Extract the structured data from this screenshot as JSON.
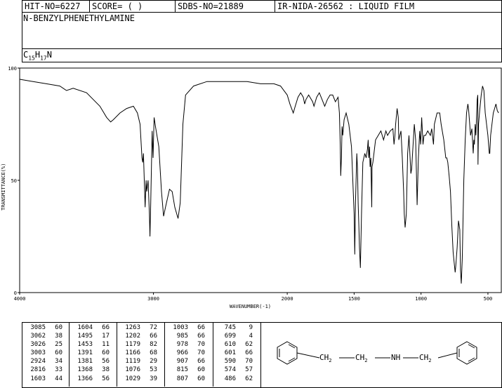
{
  "header": {
    "hit_no": "HIT-NO=6227",
    "score": "SCORE=  (  )",
    "sdbs_no": "SDBS-NO=21889",
    "ir_nida": "IR-NIDA-26562 : LIQUID FILM"
  },
  "compound": {
    "name": "N-BENZYLPHENETHYLAMINE",
    "formula_c": "C",
    "formula_c_sub": "15",
    "formula_h": "H",
    "formula_h_sub": "17",
    "formula_n": "N"
  },
  "chart_data": {
    "type": "line",
    "title": "",
    "xlabel": "WAVENUMBER(-1)",
    "ylabel": "TRANSMITTANCE(%)",
    "xlim": [
      4000,
      400
    ],
    "ylim": [
      0,
      100
    ],
    "x_ticks": [
      4000,
      3000,
      2000,
      1500,
      1000,
      500
    ],
    "y_ticks": [
      0,
      50,
      100
    ],
    "x_tick_labels": [
      "4000",
      "3000",
      "2000",
      "1500",
      "1000",
      "500"
    ],
    "y_tick_labels": [
      "0",
      "50",
      "100"
    ],
    "grid": false,
    "series": [
      {
        "points": [
          [
            4000,
            95
          ],
          [
            3900,
            94
          ],
          [
            3800,
            93
          ],
          [
            3700,
            92
          ],
          [
            3650,
            90
          ],
          [
            3600,
            91
          ],
          [
            3500,
            89
          ],
          [
            3450,
            86
          ],
          [
            3400,
            83
          ],
          [
            3350,
            78
          ],
          [
            3320,
            76
          ],
          [
            3300,
            77
          ],
          [
            3250,
            80
          ],
          [
            3200,
            82
          ],
          [
            3150,
            83
          ],
          [
            3120,
            80
          ],
          [
            3100,
            75
          ],
          [
            3086,
            60
          ],
          [
            3080,
            58
          ],
          [
            3075,
            62
          ],
          [
            3062,
            38
          ],
          [
            3055,
            50
          ],
          [
            3050,
            45
          ],
          [
            3040,
            50
          ],
          [
            3030,
            35
          ],
          [
            3026,
            25
          ],
          [
            3020,
            40
          ],
          [
            3010,
            72
          ],
          [
            3003,
            60
          ],
          [
            2995,
            78
          ],
          [
            2985,
            74
          ],
          [
            2960,
            65
          ],
          [
            2940,
            45
          ],
          [
            2924,
            34
          ],
          [
            2910,
            38
          ],
          [
            2880,
            46
          ],
          [
            2860,
            45
          ],
          [
            2840,
            38
          ],
          [
            2816,
            33
          ],
          [
            2800,
            40
          ],
          [
            2780,
            75
          ],
          [
            2760,
            88
          ],
          [
            2700,
            92
          ],
          [
            2600,
            94
          ],
          [
            2500,
            94
          ],
          [
            2400,
            94
          ],
          [
            2300,
            94
          ],
          [
            2200,
            93
          ],
          [
            2100,
            93
          ],
          [
            2050,
            92
          ],
          [
            2000,
            88
          ],
          [
            1980,
            84
          ],
          [
            1955,
            80
          ],
          [
            1940,
            83
          ],
          [
            1920,
            87
          ],
          [
            1900,
            89
          ],
          [
            1880,
            87
          ],
          [
            1870,
            84
          ],
          [
            1860,
            86
          ],
          [
            1840,
            88
          ],
          [
            1810,
            85
          ],
          [
            1800,
            83
          ],
          [
            1780,
            87
          ],
          [
            1760,
            89
          ],
          [
            1740,
            86
          ],
          [
            1720,
            83
          ],
          [
            1700,
            86
          ],
          [
            1680,
            88
          ],
          [
            1660,
            88
          ],
          [
            1640,
            85
          ],
          [
            1620,
            87
          ],
          [
            1610,
            80
          ],
          [
            1604,
            66
          ],
          [
            1600,
            52
          ],
          [
            1595,
            60
          ],
          [
            1590,
            74
          ],
          [
            1585,
            70
          ],
          [
            1575,
            77
          ],
          [
            1560,
            80
          ],
          [
            1540,
            75
          ],
          [
            1520,
            65
          ],
          [
            1500,
            35
          ],
          [
            1495,
            17
          ],
          [
            1490,
            40
          ],
          [
            1480,
            62
          ],
          [
            1475,
            55
          ],
          [
            1470,
            40
          ],
          [
            1465,
            30
          ],
          [
            1460,
            20
          ],
          [
            1453,
            11
          ],
          [
            1445,
            35
          ],
          [
            1435,
            58
          ],
          [
            1420,
            62
          ],
          [
            1410,
            60
          ],
          [
            1400,
            64
          ],
          [
            1395,
            68
          ],
          [
            1391,
            60
          ],
          [
            1385,
            65
          ],
          [
            1381,
            56
          ],
          [
            1375,
            60
          ],
          [
            1368,
            38
          ],
          [
            1366,
            56
          ],
          [
            1360,
            58
          ],
          [
            1340,
            68
          ],
          [
            1320,
            70
          ],
          [
            1300,
            72
          ],
          [
            1280,
            68
          ],
          [
            1263,
            72
          ],
          [
            1250,
            70
          ],
          [
            1230,
            72
          ],
          [
            1210,
            73
          ],
          [
            1202,
            66
          ],
          [
            1195,
            70
          ],
          [
            1190,
            75
          ],
          [
            1179,
            82
          ],
          [
            1170,
            78
          ],
          [
            1166,
            68
          ],
          [
            1150,
            72
          ],
          [
            1140,
            60
          ],
          [
            1130,
            45
          ],
          [
            1125,
            35
          ],
          [
            1119,
            29
          ],
          [
            1110,
            35
          ],
          [
            1100,
            62
          ],
          [
            1090,
            70
          ],
          [
            1076,
            53
          ],
          [
            1070,
            55
          ],
          [
            1060,
            65
          ],
          [
            1050,
            75
          ],
          [
            1040,
            68
          ],
          [
            1035,
            55
          ],
          [
            1029,
            39
          ],
          [
            1020,
            60
          ],
          [
            1010,
            72
          ],
          [
            1003,
            66
          ],
          [
            995,
            78
          ],
          [
            985,
            66
          ],
          [
            978,
            70
          ],
          [
            966,
            70
          ],
          [
            950,
            72
          ],
          [
            930,
            70
          ],
          [
            920,
            73
          ],
          [
            907,
            66
          ],
          [
            900,
            75
          ],
          [
            880,
            80
          ],
          [
            860,
            80
          ],
          [
            850,
            75
          ],
          [
            830,
            68
          ],
          [
            815,
            60
          ],
          [
            807,
            60
          ],
          [
            800,
            58
          ],
          [
            790,
            52
          ],
          [
            780,
            45
          ],
          [
            770,
            30
          ],
          [
            760,
            18
          ],
          [
            750,
            12
          ],
          [
            745,
            9
          ],
          [
            740,
            12
          ],
          [
            730,
            20
          ],
          [
            720,
            32
          ],
          [
            710,
            28
          ],
          [
            705,
            10
          ],
          [
            699,
            4
          ],
          [
            692,
            15
          ],
          [
            680,
            50
          ],
          [
            670,
            68
          ],
          [
            660,
            80
          ],
          [
            650,
            84
          ],
          [
            645,
            82
          ],
          [
            640,
            78
          ],
          [
            630,
            70
          ],
          [
            620,
            73
          ],
          [
            610,
            62
          ],
          [
            605,
            68
          ],
          [
            601,
            66
          ],
          [
            595,
            75
          ],
          [
            590,
            70
          ],
          [
            585,
            78
          ],
          [
            580,
            86
          ],
          [
            576,
            88
          ],
          [
            574,
            57
          ],
          [
            570,
            75
          ],
          [
            560,
            82
          ],
          [
            550,
            88
          ],
          [
            540,
            92
          ],
          [
            530,
            90
          ],
          [
            520,
            80
          ],
          [
            500,
            70
          ],
          [
            490,
            62
          ],
          [
            486,
            62
          ],
          [
            480,
            70
          ],
          [
            470,
            75
          ],
          [
            460,
            80
          ],
          [
            450,
            82
          ],
          [
            440,
            84
          ],
          [
            430,
            81
          ],
          [
            420,
            80
          ]
        ]
      }
    ]
  },
  "peak_table": {
    "columns": [
      [
        "3085",
        "60",
        "3062",
        "38",
        "3026",
        "25",
        "3003",
        "60",
        "2924",
        "34",
        "2816",
        "33",
        "1603",
        "44"
      ],
      [
        "1604",
        "66",
        "1495",
        "17",
        "1453",
        "11",
        "1391",
        "60",
        "1381",
        "56",
        "1368",
        "38",
        "1366",
        "56"
      ],
      [
        "1263",
        "72",
        "1202",
        "66",
        "1179",
        "82",
        "1166",
        "68",
        "1119",
        "29",
        "1076",
        "53",
        "1029",
        "39"
      ],
      [
        "1003",
        "66",
        "985",
        "66",
        "978",
        "70",
        "966",
        "70",
        "907",
        "66",
        "815",
        "60",
        "807",
        "60"
      ],
      [
        "745",
        "9",
        "699",
        "4",
        "610",
        "62",
        "601",
        "66",
        "590",
        "70",
        "574",
        "57",
        "486",
        "62"
      ]
    ]
  },
  "structure": {
    "ch2_a": "CH",
    "ch2_a_sub": "2",
    "ch2_b": "CH",
    "ch2_b_sub": "2",
    "nh": "NH",
    "ch2_c": "CH",
    "ch2_c_sub": "2"
  }
}
